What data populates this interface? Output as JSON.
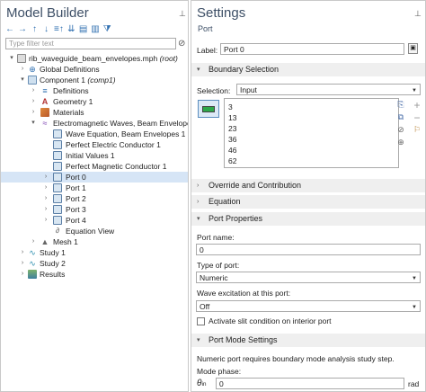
{
  "model_builder": {
    "title": "Model Builder",
    "filter_placeholder": "Type filter text",
    "tree": [
      {
        "label": "rib_waveguide_beam_envelopes.mph",
        "suffix": "(root)"
      },
      {
        "label": "Global Definitions",
        "suffix": ""
      },
      {
        "label": "Component 1",
        "suffix": "(comp1)"
      },
      {
        "label": "Definitions",
        "suffix": ""
      },
      {
        "label": "Geometry 1",
        "suffix": ""
      },
      {
        "label": "Materials",
        "suffix": ""
      },
      {
        "label": "Electromagnetic Waves, Beam Envelopes",
        "suffix": ""
      },
      {
        "label": "Wave Equation, Beam Envelopes 1",
        "suffix": ""
      },
      {
        "label": "Perfect Electric Conductor 1",
        "suffix": ""
      },
      {
        "label": "Initial Values 1",
        "suffix": ""
      },
      {
        "label": "Perfect Magnetic Conductor 1",
        "suffix": ""
      },
      {
        "label": "Port 0",
        "suffix": ""
      },
      {
        "label": "Port 1",
        "suffix": ""
      },
      {
        "label": "Port 2",
        "suffix": ""
      },
      {
        "label": "Port 3",
        "suffix": ""
      },
      {
        "label": "Port 4",
        "suffix": ""
      },
      {
        "label": "Equation View",
        "suffix": ""
      },
      {
        "label": "Mesh 1",
        "suffix": ""
      },
      {
        "label": "Study 1",
        "suffix": ""
      },
      {
        "label": "Study 2",
        "suffix": ""
      },
      {
        "label": "Results",
        "suffix": ""
      }
    ]
  },
  "settings": {
    "title": "Settings",
    "subtitle": "Port",
    "label_caption": "Label:",
    "label_value": "Port 0",
    "sections": {
      "boundary_selection": "Boundary Selection",
      "override": "Override and Contribution",
      "equation": "Equation",
      "port_properties": "Port Properties",
      "port_mode": "Port Mode Settings"
    },
    "selection_caption": "Selection:",
    "selection_value": "Input",
    "boundaries": [
      "3",
      "13",
      "23",
      "36",
      "46",
      "62"
    ],
    "port_name_caption": "Port name:",
    "port_name_value": "0",
    "port_type_caption": "Type of port:",
    "port_type_value": "Numeric",
    "wave_excitation_caption": "Wave excitation at this port:",
    "wave_excitation_value": "Off",
    "slit_caption": "Activate slit condition on interior port",
    "port_mode_note": "Numeric port requires boundary mode analysis study step.",
    "mode_phase_caption": "Mode phase:",
    "theta_symbol": "θ",
    "theta_sub": "in",
    "theta_value": "0",
    "theta_unit": "rad"
  }
}
